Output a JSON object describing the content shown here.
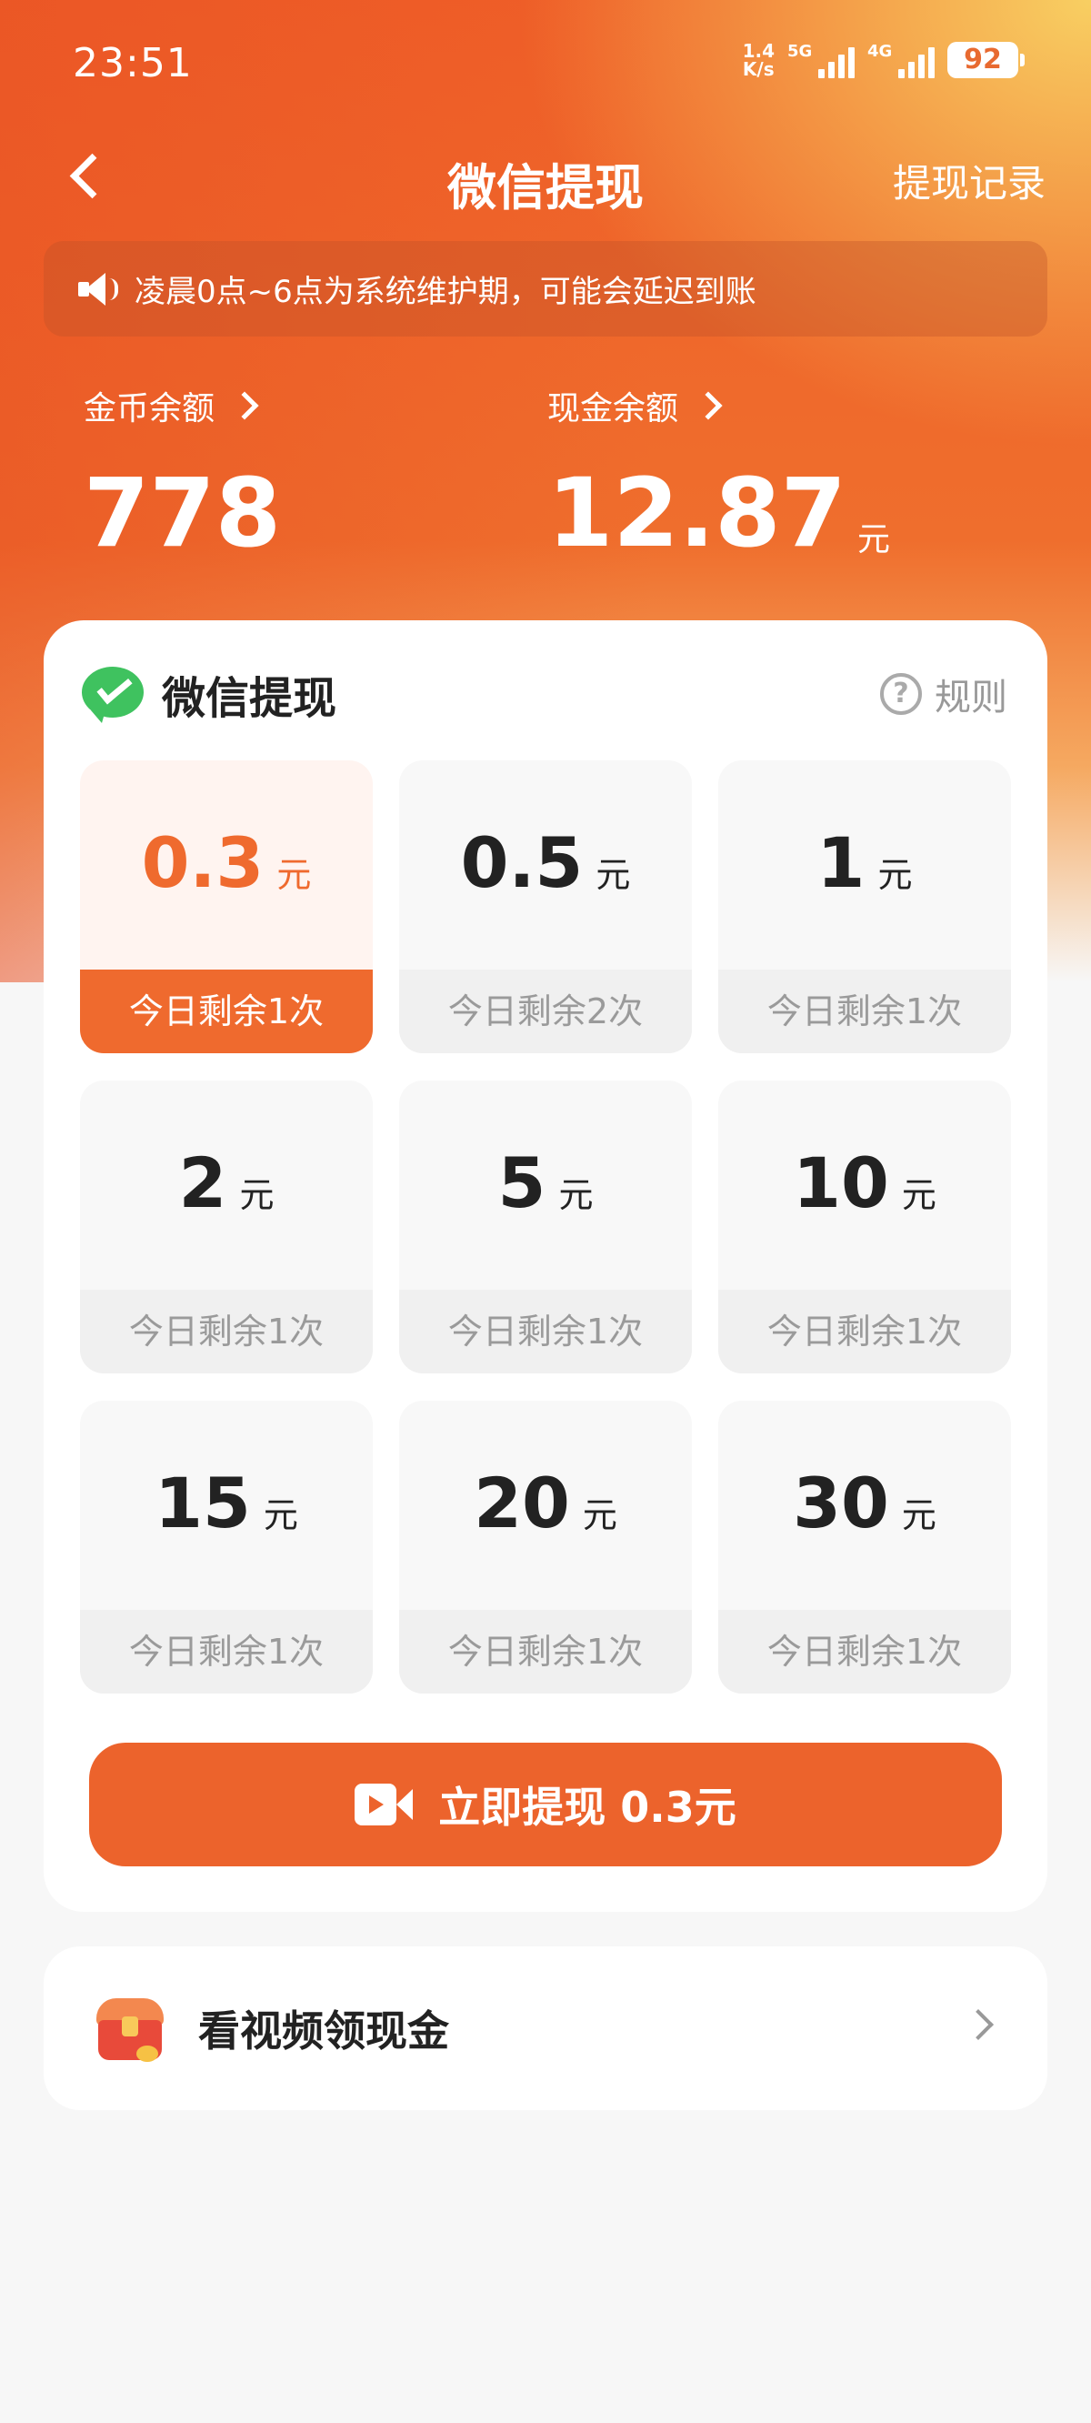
{
  "status_bar": {
    "time": "23:51",
    "net_speed_value": "1.4",
    "net_speed_unit": "K/s",
    "signal1_label": "5G",
    "signal2_label": "4G",
    "battery": "92"
  },
  "header": {
    "title": "微信提现",
    "history_label": "提现记录"
  },
  "notice": {
    "text": "凌晨0点~6点为系统维护期，可能会延迟到账"
  },
  "balances": {
    "coin_label": "金币余额",
    "coin_value": "778",
    "cash_label": "现金余额",
    "cash_value": "12.87",
    "cash_unit": "元"
  },
  "card": {
    "title": "微信提现",
    "rules_label": "规则",
    "options": [
      {
        "amount": "0.3",
        "unit": "元",
        "remain": "今日剩余1次",
        "selected": true
      },
      {
        "amount": "0.5",
        "unit": "元",
        "remain": "今日剩余2次",
        "selected": false
      },
      {
        "amount": "1",
        "unit": "元",
        "remain": "今日剩余1次",
        "selected": false
      },
      {
        "amount": "2",
        "unit": "元",
        "remain": "今日剩余1次",
        "selected": false
      },
      {
        "amount": "5",
        "unit": "元",
        "remain": "今日剩余1次",
        "selected": false
      },
      {
        "amount": "10",
        "unit": "元",
        "remain": "今日剩余1次",
        "selected": false
      },
      {
        "amount": "15",
        "unit": "元",
        "remain": "今日剩余1次",
        "selected": false
      },
      {
        "amount": "20",
        "unit": "元",
        "remain": "今日剩余1次",
        "selected": false
      },
      {
        "amount": "30",
        "unit": "元",
        "remain": "今日剩余1次",
        "selected": false
      }
    ],
    "withdraw_button": "立即提现 0.3元"
  },
  "promo": {
    "label": "看视频领现金"
  },
  "colors": {
    "accent": "#ec632c",
    "wechat_green": "#3fc25f",
    "gold": "#f8cf62"
  }
}
